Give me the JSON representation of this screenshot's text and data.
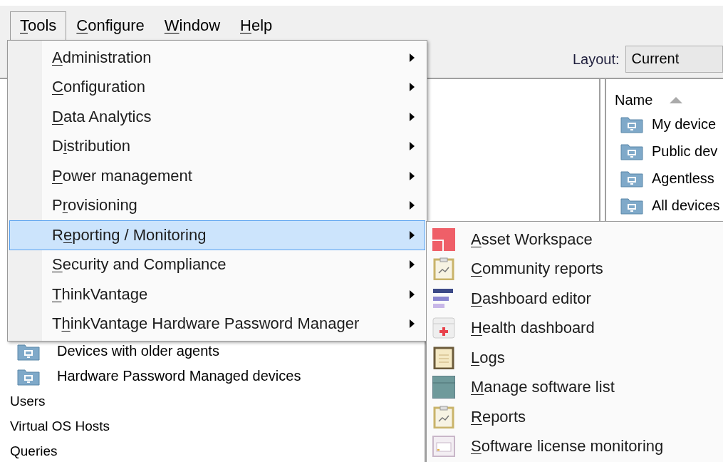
{
  "menu_bar": [
    {
      "label": {
        "key": "T",
        "after": "ools"
      },
      "selected": true
    },
    {
      "label": {
        "key": "C",
        "after": "onfigure"
      },
      "selected": false
    },
    {
      "label": {
        "key": "W",
        "after": "indow"
      },
      "selected": false
    },
    {
      "label": {
        "key": "H",
        "after": "elp"
      },
      "selected": false
    }
  ],
  "toolbar": {
    "layout_label": "Layout:",
    "layout_value": "Current"
  },
  "tree": [
    {
      "kind": "folder",
      "label": "Devices with older agents"
    },
    {
      "kind": "folder",
      "label": "Hardware Password Managed devices"
    },
    {
      "kind": "plain",
      "label": "Users"
    },
    {
      "kind": "plain",
      "label": "Virtual OS Hosts"
    },
    {
      "kind": "plain",
      "label": "Queries"
    }
  ],
  "list_panel": {
    "column": "Name",
    "rows": [
      "My device",
      "Public dev",
      "Agentless",
      "All devices"
    ]
  },
  "menu": [
    {
      "label": {
        "key": "A",
        "after": "dministration"
      },
      "selected": false
    },
    {
      "label": {
        "key": "C",
        "after": "onfiguration"
      },
      "selected": false
    },
    {
      "label": {
        "key": "D",
        "after": "ata Analytics"
      },
      "selected": false
    },
    {
      "label": {
        "before": "D",
        "key": "i",
        "after": "stribution"
      },
      "selected": false
    },
    {
      "label": {
        "key": "P",
        "after": "ower management"
      },
      "selected": false
    },
    {
      "label": {
        "before": "P",
        "key": "r",
        "after": "ovisioning"
      },
      "selected": false
    },
    {
      "label": {
        "before": "R",
        "key": "e",
        "after": "porting / Monitoring"
      },
      "selected": true
    },
    {
      "label": {
        "key": "S",
        "after": "ecurity and Compliance"
      },
      "selected": false
    },
    {
      "label": {
        "key": "T",
        "after": "hinkVantage"
      },
      "selected": false
    },
    {
      "label": {
        "before": "T",
        "key": "h",
        "after": "inkVantage Hardware Password Manager"
      },
      "selected": false
    }
  ],
  "submenu": [
    {
      "kind": "asset",
      "label": {
        "key": "A",
        "after": "sset Workspace"
      }
    },
    {
      "kind": "report",
      "label": {
        "key": "C",
        "after": "ommunity reports"
      }
    },
    {
      "kind": "dashboard",
      "label": {
        "key": "D",
        "after": "ashboard editor"
      }
    },
    {
      "kind": "health",
      "label": {
        "key": "H",
        "after": "ealth dashboard"
      }
    },
    {
      "kind": "log",
      "label": {
        "key": "L",
        "after": "ogs"
      }
    },
    {
      "kind": "software",
      "label": {
        "key": "M",
        "after": "anage software list"
      }
    },
    {
      "kind": "report",
      "label": {
        "key": "R",
        "after": "eports"
      }
    },
    {
      "kind": "license",
      "label": {
        "key": "S",
        "after": "oftware license monitoring"
      }
    }
  ]
}
